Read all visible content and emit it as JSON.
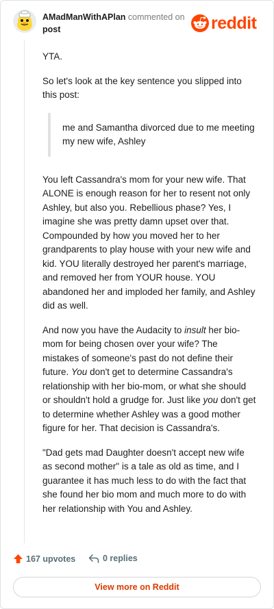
{
  "header": {
    "username": "AMadManWithAPlan",
    "action": "commented on",
    "post_label": "post",
    "logo_text": "reddit",
    "brand_color": "#ff4500"
  },
  "comment": {
    "p1": "YTA.",
    "p2": "So let's look at the key sentence you slipped into this post:",
    "quote": "me and Samantha divorced due to me meeting my new wife, Ashley",
    "p3": "You left Cassandra's mom for your new wife. That ALONE is enough reason for her to resent not only Ashley, but also you. Rebellious phase? Yes, I imagine she was pretty damn upset over that. Compounded by how you moved her to her grandparents to play house with your new wife and kid. YOU literally destroyed her parent's marriage, and removed her from YOUR house. YOU abandoned her and imploded her family, and Ashley did as well.",
    "p4_a": "And now you have the Audacity to ",
    "p4_b": "insult",
    "p4_c": " her bio-mom for being chosen over your wife? The mistakes of someone's past do not define their future. ",
    "p4_d": "You",
    "p4_e": " don't get to determine Cassandra's relationship with her bio-mom, or what she should or shouldn't hold a grudge for. Just like ",
    "p4_f": "you",
    "p4_g": " don't get to determine whether Ashley was a good mother figure for her. That decision is Cassandra's.",
    "p5": "\"Dad gets mad Daughter doesn't accept new wife as second mother\" is a tale as old as time, and I guarantee it has much less to do with the fact that she found her bio mom and much more to do with her relationship with You and Ashley."
  },
  "footer": {
    "upvotes": "167 upvotes",
    "replies": "0 replies",
    "upvote_icon": "upvote-arrow-icon",
    "reply_icon": "reply-arrow-icon"
  },
  "cta": {
    "label": "View more on Reddit"
  }
}
